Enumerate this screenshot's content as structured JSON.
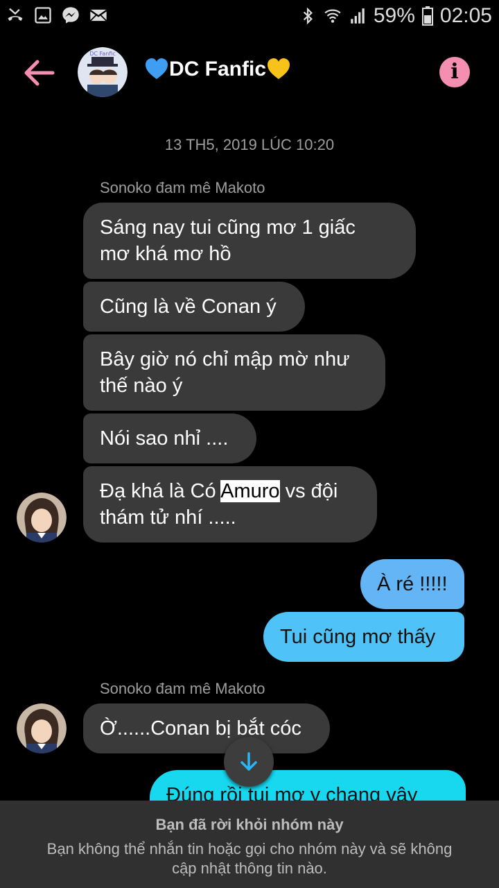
{
  "status_bar": {
    "battery": "59%",
    "time": "02:05",
    "left_icons": [
      "missed-call-icon",
      "gallery-icon",
      "messenger-icon",
      "mail-icon"
    ],
    "right_icons": [
      "bluetooth-icon",
      "wifi-icon",
      "signal-icon",
      "battery-icon"
    ]
  },
  "header": {
    "title": "DC Fanfic",
    "left_emoji": "blue-heart-icon",
    "right_emoji": "yellow-heart-icon",
    "back_icon": "back-arrow-icon",
    "info_icon": "info-icon",
    "info_glyph": "i",
    "avatar_text": "DC Fanfic"
  },
  "conversation": {
    "timestamp": "13 TH5, 2019 LÚC 10:20",
    "sender_1": "Sonoko đam mê Makoto",
    "msg1_line1": "Sáng nay tui cũng mơ 1 giấc",
    "msg1_line2": "mơ khá mơ hồ",
    "msg2": "Cũng là về Conan ý",
    "msg3_line1": "Bây giờ nó chỉ mập mờ như",
    "msg3_line2": "thế nào ý",
    "msg4": "Nói sao nhỉ ....",
    "msg5_pre": "Đạ khá là Có ",
    "msg5_highlight": "Amuro",
    "msg5_post": " vs đội",
    "msg5_line2": "thám tử nhí .....",
    "out1": "À ré !!!!!",
    "out2": "Tui cũng mơ thấy",
    "sender_2": "Sonoko đam mê Makoto",
    "msg6": "Ờ......Conan bị bắt cóc",
    "out3_partial": "Đúng rồi tui mơ y chang vậy"
  },
  "notice": {
    "title": "Bạn đã rời khỏi nhóm này",
    "body": "Bạn không thể nhắn tin hoặc gọi cho nhóm này và sẽ không cập nhật thông tin nào."
  },
  "colors": {
    "accent_pink": "#f48fb1",
    "incoming_bubble": "#3a3a3a",
    "outgoing_light": "#64b5f6",
    "outgoing_cyan": "#4fc3f7",
    "outgoing_bright": "#18d8f0"
  }
}
